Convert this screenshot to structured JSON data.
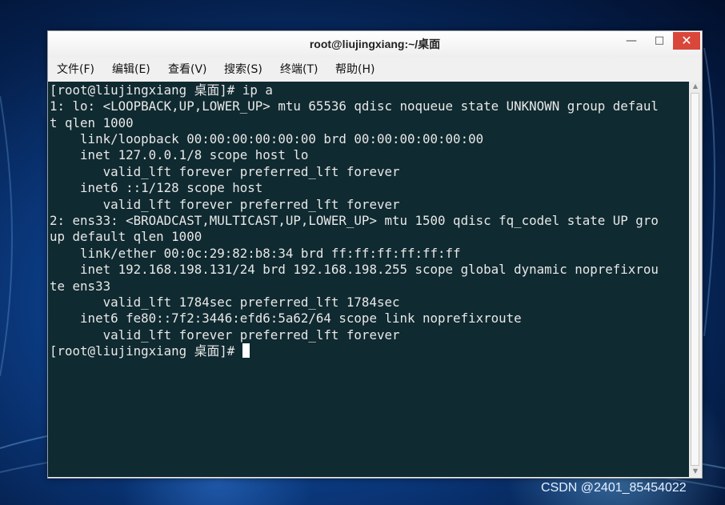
{
  "window": {
    "title": "root@liujingxiang:~/桌面",
    "controls": {
      "minimize": "—",
      "maximize": "□",
      "close": "✕"
    }
  },
  "menubar": {
    "items": [
      {
        "label": "文件(F)"
      },
      {
        "label": "编辑(E)"
      },
      {
        "label": "查看(V)"
      },
      {
        "label": "搜索(S)"
      },
      {
        "label": "终端(T)"
      },
      {
        "label": "帮助(H)"
      }
    ]
  },
  "terminal": {
    "lines": [
      "[root@liujingxiang 桌面]# ip a",
      "1: lo: <LOOPBACK,UP,LOWER_UP> mtu 65536 qdisc noqueue state UNKNOWN group defaul",
      "t qlen 1000",
      "    link/loopback 00:00:00:00:00:00 brd 00:00:00:00:00:00",
      "    inet 127.0.0.1/8 scope host lo",
      "       valid_lft forever preferred_lft forever",
      "    inet6 ::1/128 scope host",
      "       valid_lft forever preferred_lft forever",
      "2: ens33: <BROADCAST,MULTICAST,UP,LOWER_UP> mtu 1500 qdisc fq_codel state UP gro",
      "up default qlen 1000",
      "    link/ether 00:0c:29:82:b8:34 brd ff:ff:ff:ff:ff:ff",
      "    inet 192.168.198.131/24 brd 192.168.198.255 scope global dynamic noprefixrou",
      "te ens33",
      "       valid_lft 1784sec preferred_lft 1784sec",
      "    inet6 fe80::7f2:3446:efd6:5a62/64 scope link noprefixroute",
      "       valid_lft forever preferred_lft forever"
    ],
    "prompt": "[root@liujingxiang 桌面]# "
  },
  "watermark": "CSDN @2401_85454022",
  "colors": {
    "terminal_bg": "#0f2a30",
    "terminal_fg": "#e8e8e8",
    "close_button": "#d9473b"
  }
}
